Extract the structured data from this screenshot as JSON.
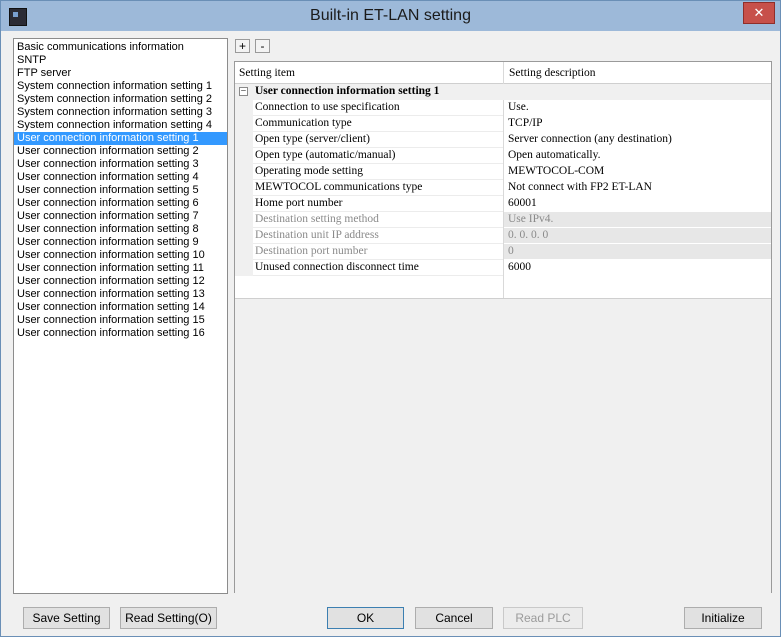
{
  "window": {
    "title": "Built-in ET-LAN setting",
    "close_label": "✕"
  },
  "toolbar": {
    "expand_label": "+",
    "collapse_label": "-"
  },
  "nav": {
    "items": [
      "Basic communications information",
      "SNTP",
      "FTP server",
      "System connection information setting 1",
      "System connection information setting 2",
      "System connection information setting 3",
      "System connection information setting 4",
      "User connection information setting 1",
      "User connection information setting 2",
      "User connection information setting 3",
      "User connection information setting 4",
      "User connection information setting 5",
      "User connection information setting 6",
      "User connection information setting 7",
      "User connection information setting 8",
      "User connection information setting 9",
      "User connection information setting 10",
      "User connection information setting 11",
      "User connection information setting 12",
      "User connection information setting 13",
      "User connection information setting 14",
      "User connection information setting 15",
      "User connection information setting 16"
    ],
    "selected": "User connection information setting 1"
  },
  "grid": {
    "header_item": "Setting item",
    "header_desc": "Setting description",
    "group": "User connection information setting 1",
    "rows": [
      {
        "name": "Connection to use specification",
        "value": "Use.",
        "disabled": false
      },
      {
        "name": "Communication type",
        "value": "TCP/IP",
        "disabled": false
      },
      {
        "name": "Open type (server/client)",
        "value": "Server connection (any destination)",
        "disabled": false
      },
      {
        "name": "Open type (automatic/manual)",
        "value": "Open automatically.",
        "disabled": false
      },
      {
        "name": "Operating mode setting",
        "value": "MEWTOCOL-COM",
        "disabled": false
      },
      {
        "name": "MEWTOCOL communications type",
        "value": "Not connect with FP2 ET-LAN",
        "disabled": false
      },
      {
        "name": "Home port number",
        "value": "60001",
        "disabled": false
      },
      {
        "name": "Destination setting method",
        "value": "Use IPv4.",
        "disabled": true
      },
      {
        "name": "Destination unit IP address",
        "value": "  0.  0.  0.  0",
        "disabled": true
      },
      {
        "name": "Destination port number",
        "value": "0",
        "disabled": true
      },
      {
        "name": "Unused connection disconnect time",
        "value": "6000",
        "disabled": false
      }
    ]
  },
  "buttons": {
    "save": "Save Setting",
    "read": "Read Setting(O)",
    "ok": "OK",
    "cancel": "Cancel",
    "read_plc": "Read PLC",
    "initialize": "Initialize"
  }
}
